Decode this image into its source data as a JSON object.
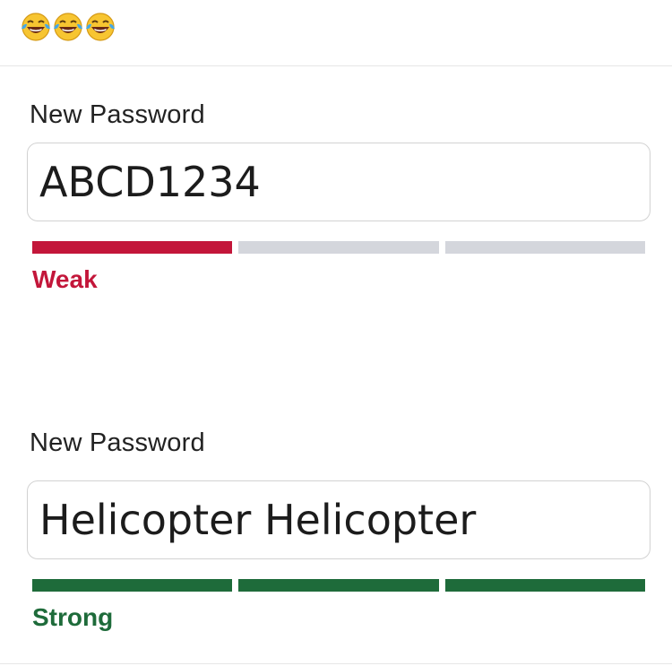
{
  "header": {
    "reactions": [
      "tears-of-joy-emoji",
      "tears-of-joy-emoji",
      "tears-of-joy-emoji"
    ]
  },
  "fields": [
    {
      "label": "New Password",
      "value": "ABCD1234",
      "strength_label": "Weak",
      "strength_color": "#c3163a",
      "meter_filled_segments": 1,
      "meter_total_segments": 3
    },
    {
      "label": "New Password",
      "value": "Helicopter Helicopter",
      "strength_label": "Strong",
      "strength_color": "#1e6b3a",
      "meter_filled_segments": 3,
      "meter_total_segments": 3
    }
  ],
  "colors": {
    "meter_empty": "#d4d6dc",
    "weak": "#c3163a",
    "strong": "#1e6b3a"
  }
}
